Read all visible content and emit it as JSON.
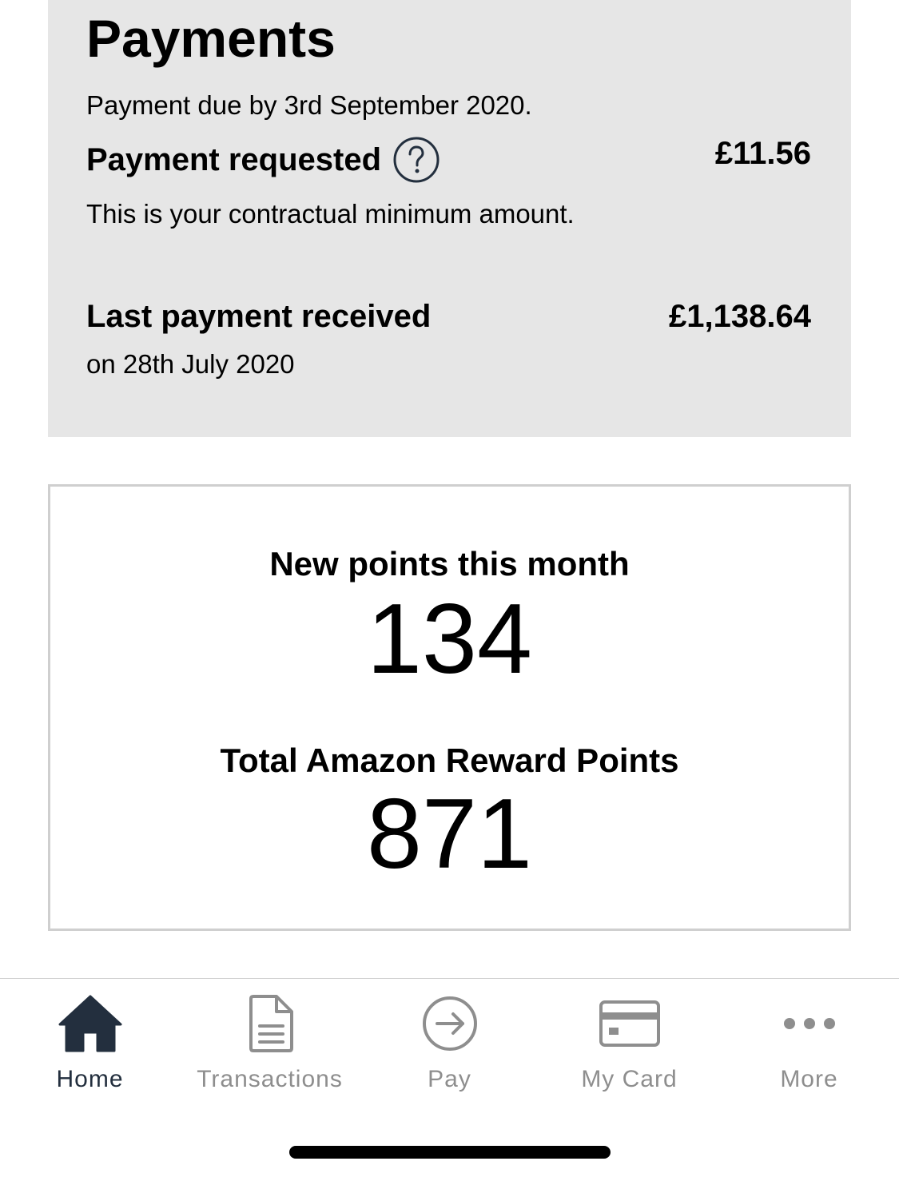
{
  "payments": {
    "title": "Payments",
    "due_text": "Payment due by 3rd September 2020.",
    "requested": {
      "label": "Payment requested",
      "amount": "£11.56",
      "note": "This is your contractual minimum amount."
    },
    "last_received": {
      "label": "Last payment received",
      "amount": "£1,138.64",
      "date_text": "on 28th July 2020"
    }
  },
  "points": {
    "new_label": "New points this month",
    "new_value": "134",
    "total_label": "Total Amazon Reward Points",
    "total_value": "871"
  },
  "tabbar": {
    "tabs": [
      {
        "label": "Home",
        "icon": "home-icon",
        "active": true
      },
      {
        "label": "Transactions",
        "icon": "document-icon",
        "active": false
      },
      {
        "label": "Pay",
        "icon": "arrow-circle-icon",
        "active": false
      },
      {
        "label": "My Card",
        "icon": "card-icon",
        "active": false
      },
      {
        "label": "More",
        "icon": "more-dots-icon",
        "active": false
      }
    ]
  },
  "colors": {
    "card_bg": "#e6e6e6",
    "active_tab": "#232f3e",
    "inactive_tab": "#8e8e8e"
  }
}
